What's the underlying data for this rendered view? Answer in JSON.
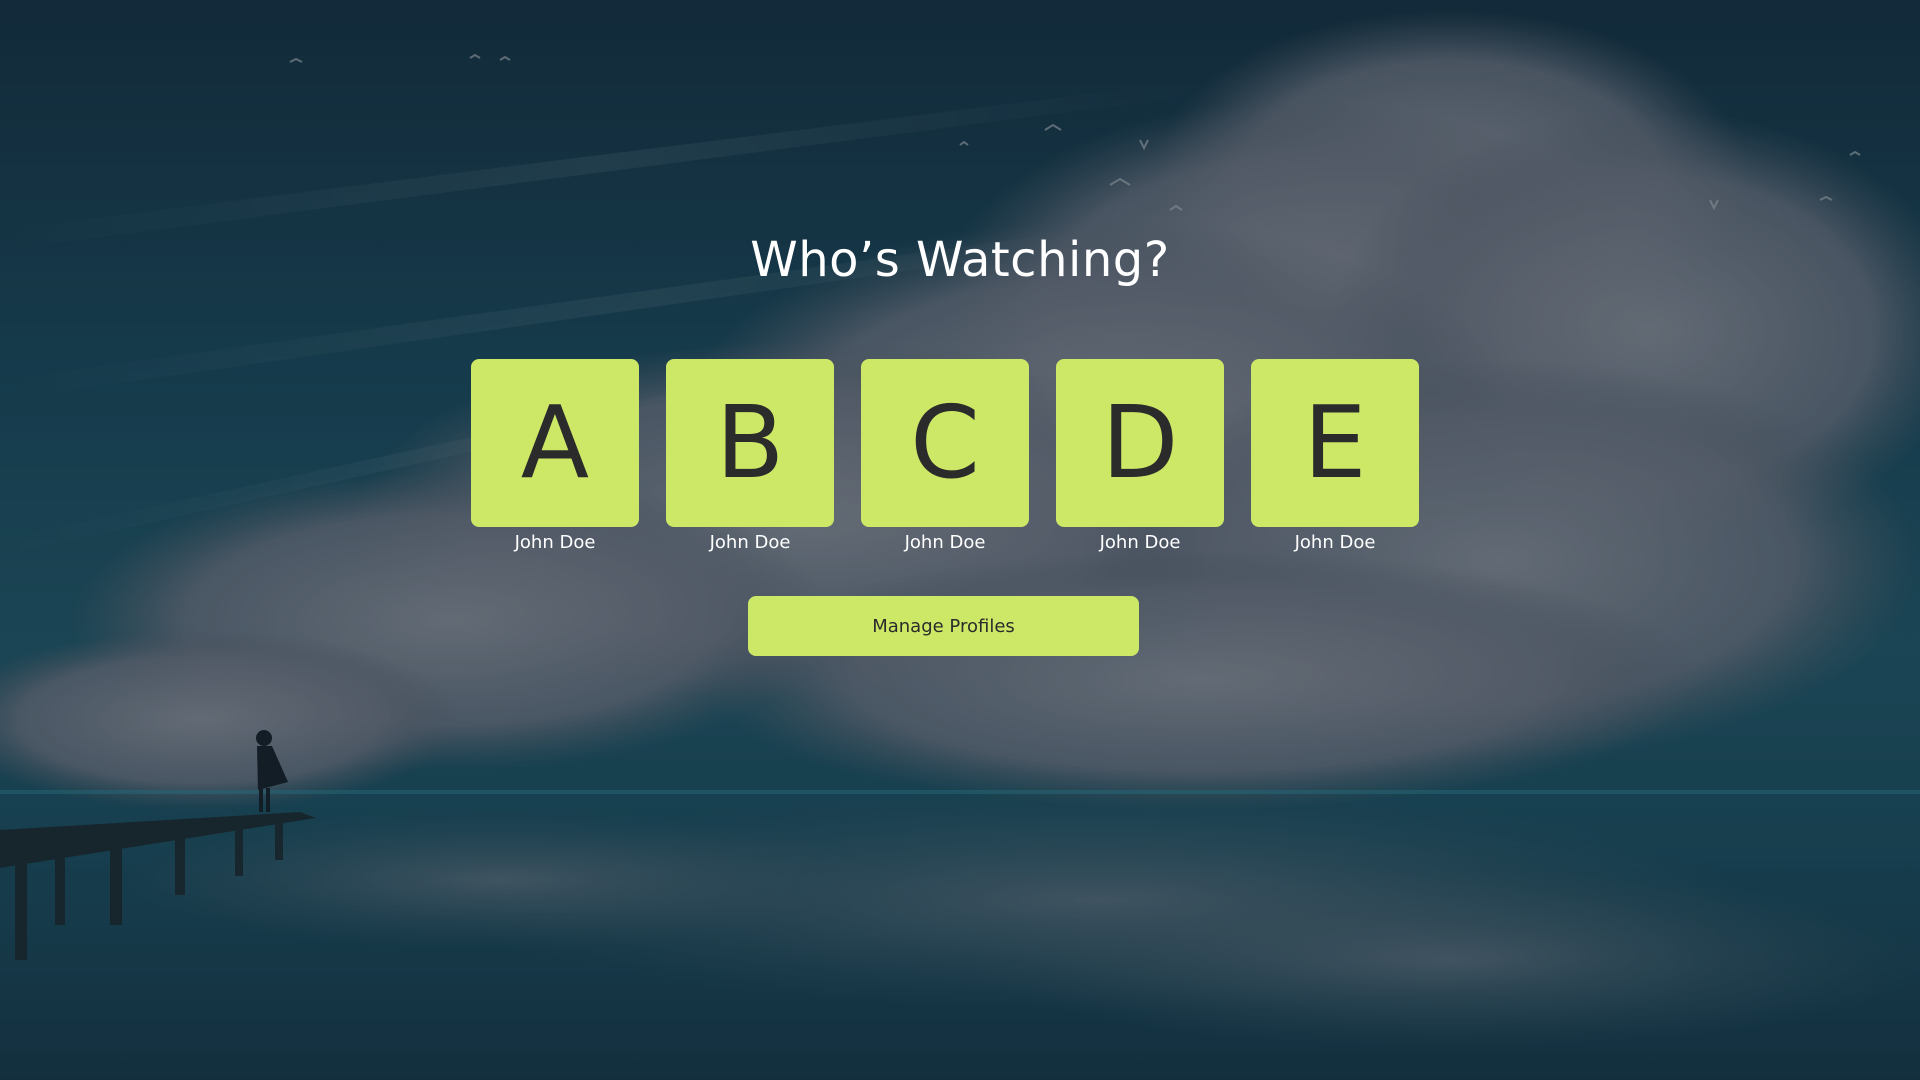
{
  "header": {
    "title": "Who’s Watching?"
  },
  "profiles": [
    {
      "initial": "A",
      "name": "John Doe"
    },
    {
      "initial": "B",
      "name": "John Doe"
    },
    {
      "initial": "C",
      "name": "John Doe"
    },
    {
      "initial": "D",
      "name": "John Doe"
    },
    {
      "initial": "E",
      "name": "John Doe"
    }
  ],
  "actions": {
    "manage_label": "Manage Profiles"
  },
  "colors": {
    "accent": "#cde866",
    "avatar_text": "#2b2b2b",
    "title_text": "#ffffff"
  }
}
